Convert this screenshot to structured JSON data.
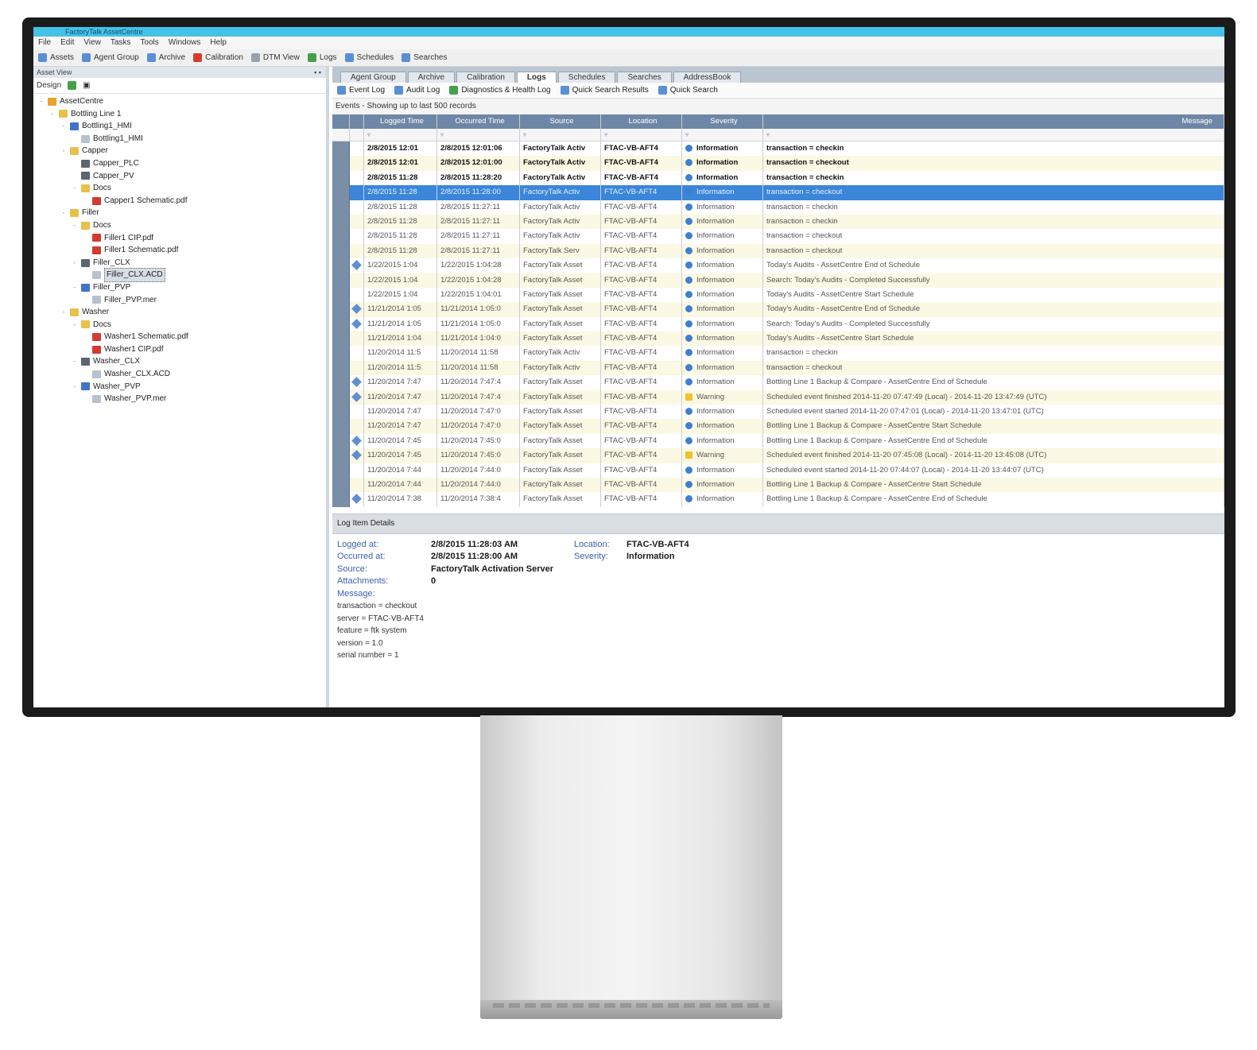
{
  "app": {
    "title": "FactoryTalk AssetCentre",
    "menu": [
      "File",
      "Edit",
      "View",
      "Tasks",
      "Tools",
      "Windows",
      "Help"
    ],
    "toolbar": [
      "Assets",
      "Agent Group",
      "Archive",
      "Calibration",
      "DTM View",
      "Logs",
      "Schedules",
      "Searches"
    ]
  },
  "left": {
    "panel_title": "Asset View",
    "tools_label": "Design",
    "tree": [
      {
        "label": "AssetCentre",
        "depth": 0,
        "icon": "root-icon",
        "exp": "-"
      },
      {
        "label": "Bottling Line 1",
        "depth": 1,
        "icon": "folder-icon",
        "exp": "-"
      },
      {
        "label": "Bottling1_HMI",
        "depth": 2,
        "icon": "computer-icon",
        "exp": "-"
      },
      {
        "label": "Bottling1_HMI",
        "depth": 3,
        "icon": "file-icon",
        "exp": ""
      },
      {
        "label": "Capper",
        "depth": 2,
        "icon": "folder-icon",
        "exp": "-"
      },
      {
        "label": "Capper_PLC",
        "depth": 3,
        "icon": "device-icon",
        "exp": ""
      },
      {
        "label": "Capper_PV",
        "depth": 3,
        "icon": "device-icon",
        "exp": ""
      },
      {
        "label": "Docs",
        "depth": 3,
        "icon": "folder-icon",
        "exp": "-"
      },
      {
        "label": "Capper1 Schematic.pdf",
        "depth": 4,
        "icon": "pdf-icon",
        "exp": ""
      },
      {
        "label": "Filler",
        "depth": 2,
        "icon": "folder-icon",
        "exp": "-"
      },
      {
        "label": "Docs",
        "depth": 3,
        "icon": "folder-icon",
        "exp": "-"
      },
      {
        "label": "Filler1 CIP.pdf",
        "depth": 4,
        "icon": "pdf-icon",
        "exp": ""
      },
      {
        "label": "Filler1 Schematic.pdf",
        "depth": 4,
        "icon": "pdf-icon",
        "exp": ""
      },
      {
        "label": "Filler_CLX",
        "depth": 3,
        "icon": "device-icon",
        "exp": "-"
      },
      {
        "label": "Filler_CLX.ACD",
        "depth": 4,
        "icon": "file-icon",
        "exp": "",
        "selected": true
      },
      {
        "label": "Filler_PVP",
        "depth": 3,
        "icon": "computer-icon",
        "exp": "-"
      },
      {
        "label": "Filler_PVP.mer",
        "depth": 4,
        "icon": "file-icon",
        "exp": ""
      },
      {
        "label": "Washer",
        "depth": 2,
        "icon": "folder-icon",
        "exp": "-"
      },
      {
        "label": "Docs",
        "depth": 3,
        "icon": "folder-icon",
        "exp": "-"
      },
      {
        "label": "Washer1 Schematic.pdf",
        "depth": 4,
        "icon": "pdf-icon",
        "exp": ""
      },
      {
        "label": "Washer1 CIP.pdf",
        "depth": 4,
        "icon": "pdf-icon",
        "exp": ""
      },
      {
        "label": "Washer_CLX",
        "depth": 3,
        "icon": "device-icon",
        "exp": "-"
      },
      {
        "label": "Washer_CLX.ACD",
        "depth": 4,
        "icon": "file-icon",
        "exp": ""
      },
      {
        "label": "Washer_PVP",
        "depth": 3,
        "icon": "computer-icon",
        "exp": "-"
      },
      {
        "label": "Washer_PVP.mer",
        "depth": 4,
        "icon": "file-icon",
        "exp": ""
      }
    ]
  },
  "right": {
    "tabs": [
      "Agent Group",
      "Archive",
      "Calibration",
      "Logs",
      "Schedules",
      "Searches",
      "AddressBook"
    ],
    "active_tab": "Logs",
    "subtools": [
      "Event Log",
      "Audit Log",
      "Diagnostics & Health Log",
      "Quick Search Results",
      "Quick Search"
    ],
    "caption": "Events - Showing up to last 500 records",
    "columns": [
      "Logged Time",
      "Occurred Time",
      "Source",
      "Location",
      "Severity",
      "Message"
    ],
    "rows": [
      {
        "logged": "2/8/2015 12:01",
        "occurred": "2/8/2015 12:01:06",
        "source": "FactoryTalk Activ",
        "location": "FTAC-VB-AFT4",
        "severity": "Information",
        "message": "transaction = checkin",
        "bold": true,
        "icon": false
      },
      {
        "logged": "2/8/2015 12:01",
        "occurred": "2/8/2015 12:01:00",
        "source": "FactoryTalk Activ",
        "location": "FTAC-VB-AFT4",
        "severity": "Information",
        "message": "transaction = checkout",
        "bold": true,
        "icon": false
      },
      {
        "logged": "2/8/2015 11:28",
        "occurred": "2/8/2015 11:28:20",
        "source": "FactoryTalk Activ",
        "location": "FTAC-VB-AFT4",
        "severity": "Information",
        "message": "transaction = checkin",
        "bold": true,
        "icon": false
      },
      {
        "logged": "2/8/2015 11:28",
        "occurred": "2/8/2015 11:28:00",
        "source": "FactoryTalk Activ",
        "location": "FTAC-VB-AFT4",
        "severity": "Information",
        "message": "transaction = checkout",
        "selected": true,
        "icon": false
      },
      {
        "logged": "2/8/2015 11:28",
        "occurred": "2/8/2015 11:27:11",
        "source": "FactoryTalk Activ",
        "location": "FTAC-VB-AFT4",
        "severity": "Information",
        "message": "transaction = checkin",
        "icon": false
      },
      {
        "logged": "2/8/2015 11:28",
        "occurred": "2/8/2015 11:27:11",
        "source": "FactoryTalk Activ",
        "location": "FTAC-VB-AFT4",
        "severity": "Information",
        "message": "transaction = checkin",
        "icon": false
      },
      {
        "logged": "2/8/2015 11:28",
        "occurred": "2/8/2015 11:27:11",
        "source": "FactoryTalk Activ",
        "location": "FTAC-VB-AFT4",
        "severity": "Information",
        "message": "transaction = checkout",
        "icon": false
      },
      {
        "logged": "2/8/2015 11:28",
        "occurred": "2/8/2015 11:27:11",
        "source": "FactoryTalk Serv",
        "location": "FTAC-VB-AFT4",
        "severity": "Information",
        "message": "transaction = checkout",
        "icon": false
      },
      {
        "logged": "1/22/2015 1:04",
        "occurred": "1/22/2015 1:04:28",
        "source": "FactoryTalk Asset",
        "location": "FTAC-VB-AFT4",
        "severity": "Information",
        "message": "Today's Audits - AssetCentre End of Schedule",
        "icon": true
      },
      {
        "logged": "1/22/2015 1:04",
        "occurred": "1/22/2015 1:04:28",
        "source": "FactoryTalk Asset",
        "location": "FTAC-VB-AFT4",
        "severity": "Information",
        "message": "Search: Today's Audits - Completed Successfully",
        "icon": false
      },
      {
        "logged": "1/22/2015 1:04",
        "occurred": "1/22/2015 1:04:01",
        "source": "FactoryTalk Asset",
        "location": "FTAC-VB-AFT4",
        "severity": "Information",
        "message": "Today's Audits - AssetCentre Start Schedule",
        "icon": false
      },
      {
        "logged": "11/21/2014 1:05",
        "occurred": "11/21/2014 1:05:0",
        "source": "FactoryTalk Asset",
        "location": "FTAC-VB-AFT4",
        "severity": "Information",
        "message": "Today's Audits - AssetCentre End of Schedule",
        "icon": true
      },
      {
        "logged": "11/21/2014 1:05",
        "occurred": "11/21/2014 1:05:0",
        "source": "FactoryTalk Asset",
        "location": "FTAC-VB-AFT4",
        "severity": "Information",
        "message": "Search: Today's Audits - Completed Successfully",
        "icon": true
      },
      {
        "logged": "11/21/2014 1:04",
        "occurred": "11/21/2014 1:04:0",
        "source": "FactoryTalk Asset",
        "location": "FTAC-VB-AFT4",
        "severity": "Information",
        "message": "Today's Audits - AssetCentre Start Schedule",
        "icon": false
      },
      {
        "logged": "11/20/2014 11:5",
        "occurred": "11/20/2014 11:58",
        "source": "FactoryTalk Activ",
        "location": "FTAC-VB-AFT4",
        "severity": "Information",
        "message": "transaction = checkin",
        "icon": false
      },
      {
        "logged": "11/20/2014 11:5",
        "occurred": "11/20/2014 11:58",
        "source": "FactoryTalk Activ",
        "location": "FTAC-VB-AFT4",
        "severity": "Information",
        "message": "transaction = checkout",
        "icon": false
      },
      {
        "logged": "11/20/2014 7:47",
        "occurred": "11/20/2014 7:47:4",
        "source": "FactoryTalk Asset",
        "location": "FTAC-VB-AFT4",
        "severity": "Information",
        "message": "Bottling Line 1 Backup & Compare - AssetCentre End of Schedule",
        "icon": true
      },
      {
        "logged": "11/20/2014 7:47",
        "occurred": "11/20/2014 7:47:4",
        "source": "FactoryTalk Asset",
        "location": "FTAC-VB-AFT4",
        "severity": "Warning",
        "message": "Scheduled event finished 2014-11-20 07:47:49 (Local) - 2014-11-20 13:47:49 (UTC)",
        "icon": true
      },
      {
        "logged": "11/20/2014 7:47",
        "occurred": "11/20/2014 7:47:0",
        "source": "FactoryTalk Asset",
        "location": "FTAC-VB-AFT4",
        "severity": "Information",
        "message": "Scheduled event started 2014-11-20 07:47:01 (Local) - 2014-11-20 13:47:01 (UTC)",
        "icon": false
      },
      {
        "logged": "11/20/2014 7:47",
        "occurred": "11/20/2014 7:47:0",
        "source": "FactoryTalk Asset",
        "location": "FTAC-VB-AFT4",
        "severity": "Information",
        "message": "Bottling Line 1 Backup & Compare - AssetCentre Start Schedule",
        "icon": false
      },
      {
        "logged": "11/20/2014 7:45",
        "occurred": "11/20/2014 7:45:0",
        "source": "FactoryTalk Asset",
        "location": "FTAC-VB-AFT4",
        "severity": "Information",
        "message": "Bottling Line 1 Backup & Compare - AssetCentre End of Schedule",
        "icon": true
      },
      {
        "logged": "11/20/2014 7:45",
        "occurred": "11/20/2014 7:45:0",
        "source": "FactoryTalk Asset",
        "location": "FTAC-VB-AFT4",
        "severity": "Warning",
        "message": "Scheduled event finished 2014-11-20 07:45:08 (Local) - 2014-11-20 13:45:08 (UTC)",
        "icon": true
      },
      {
        "logged": "11/20/2014 7:44",
        "occurred": "11/20/2014 7:44:0",
        "source": "FactoryTalk Asset",
        "location": "FTAC-VB-AFT4",
        "severity": "Information",
        "message": "Scheduled event started 2014-11-20 07:44:07 (Local) - 2014-11-20 13:44:07 (UTC)",
        "icon": false
      },
      {
        "logged": "11/20/2014 7:44",
        "occurred": "11/20/2014 7:44:0",
        "source": "FactoryTalk Asset",
        "location": "FTAC-VB-AFT4",
        "severity": "Information",
        "message": "Bottling Line 1 Backup & Compare - AssetCentre Start Schedule",
        "icon": false
      },
      {
        "logged": "11/20/2014 7:38",
        "occurred": "11/20/2014 7:38:4",
        "source": "FactoryTalk Asset",
        "location": "FTAC-VB-AFT4",
        "severity": "Information",
        "message": "Bottling Line 1 Backup & Compare - AssetCentre End of Schedule",
        "icon": true
      }
    ],
    "details": {
      "bar_label": "Log Item Details",
      "logged_label": "Logged at:",
      "logged_value": "2/8/2015 11:28:03 AM",
      "occurred_label": "Occurred at:",
      "occurred_value": "2/8/2015 11:28:00 AM",
      "source_label": "Source:",
      "source_value": "FactoryTalk Activation Server",
      "attach_label": "Attachments:",
      "attach_value": "0",
      "message_label": "Message:",
      "location_label": "Location:",
      "location_value": "FTAC-VB-AFT4",
      "severity_label": "Severity:",
      "severity_value": "Information",
      "message_lines": [
        "transaction = checkout",
        "server = FTAC-VB-AFT4",
        "feature = ftk system",
        "version = 1.0",
        "serial number = 1"
      ]
    }
  }
}
